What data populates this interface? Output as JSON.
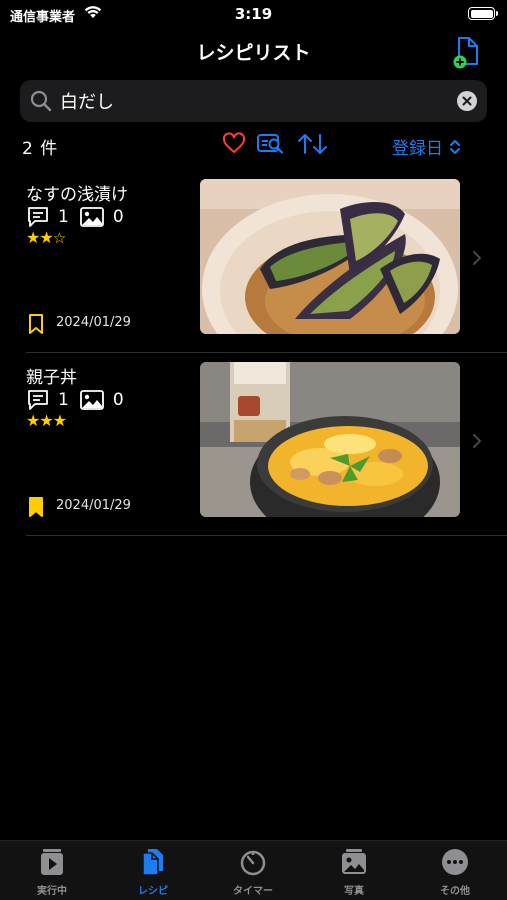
{
  "status": {
    "carrier": "通信事業者",
    "time": "3:19"
  },
  "nav": {
    "title": "レシピリスト"
  },
  "search": {
    "value": "白だし"
  },
  "list": {
    "count": "2 件",
    "sort_label": "登録日"
  },
  "recipes": [
    {
      "title": "なすの浅漬け",
      "comments": "1",
      "photos": "0",
      "rating": 2,
      "stars_on": "★★",
      "stars_off": "☆",
      "date": "2024/01/29",
      "bookmark_filled": false
    },
    {
      "title": "親子丼",
      "comments": "1",
      "photos": "0",
      "rating": 3,
      "stars_on": "★★★",
      "stars_off": "",
      "date": "2024/01/29",
      "bookmark_filled": true
    }
  ],
  "tabs": [
    {
      "label": "実行中",
      "icon": "play-icon"
    },
    {
      "label": "レシピ",
      "icon": "document-icon",
      "active": true
    },
    {
      "label": "タイマー",
      "icon": "timer-icon"
    },
    {
      "label": "写真",
      "icon": "photo-icon"
    },
    {
      "label": "その他",
      "icon": "more-icon"
    }
  ],
  "colors": {
    "accent": "#1e7cf2",
    "star": "#ffcc00",
    "heart": "#ff3b30",
    "add_badge": "#30d158"
  }
}
